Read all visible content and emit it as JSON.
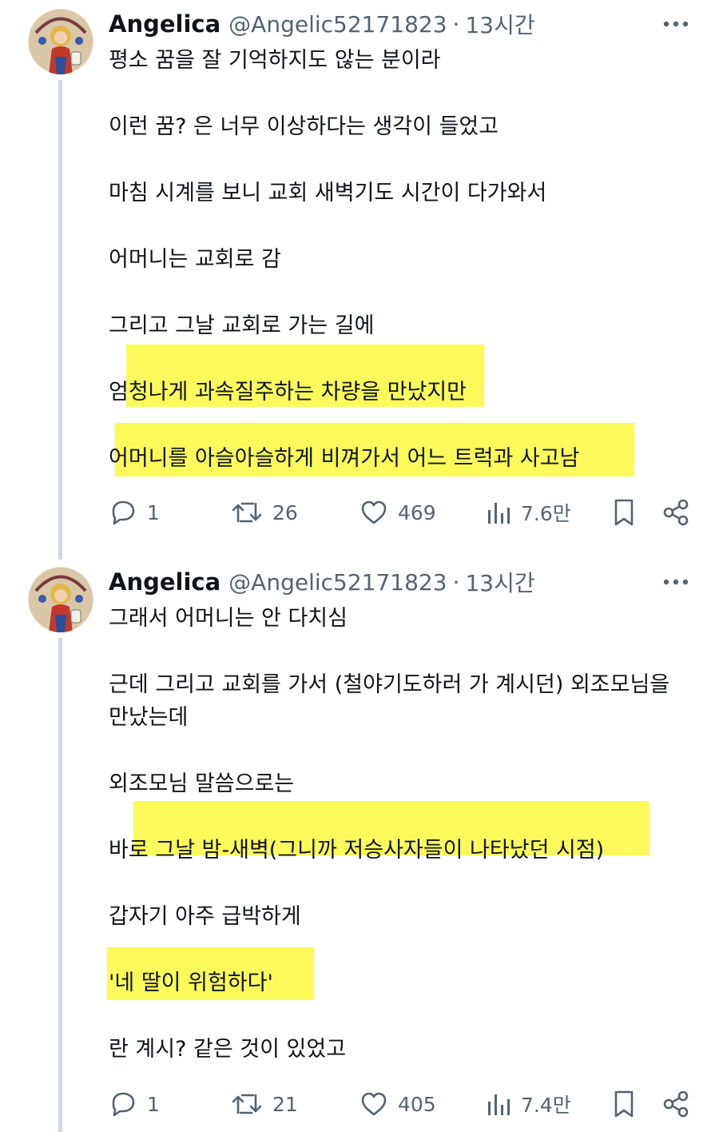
{
  "tweets": [
    {
      "author": {
        "name": "Angelica",
        "handle": "@Angelic52171823",
        "separator": "·",
        "time": "13시간"
      },
      "lines": [
        "평소 꿈을 잘 기억하지도 않는 분이라",
        "이런 꿈? 은 너무 이상하다는 생각이 들었고",
        "마침 시계를 보니 교회 새벽기도 시간이 다가와서",
        "어머니는 교회로 감",
        "그리고 그날 교회로 가는 길에",
        "엄청나게 과속질주하는 차량을 만났지만",
        "어머니를 아슬아슬하게 비껴가서 어느 트럭과 사고남"
      ],
      "stats": {
        "replies": "1",
        "retweets": "26",
        "likes": "469",
        "views": "7.6만"
      }
    },
    {
      "author": {
        "name": "Angelica",
        "handle": "@Angelic52171823",
        "separator": "·",
        "time": "13시간"
      },
      "lines": [
        "그래서 어머니는 안 다치심",
        "근데 그리고 교회를 가서 (철야기도하러 가 계시던) 외조모님을",
        "만났는데",
        "외조모님 말씀으로는",
        "바로 그날 밤-새벽(그니까 저승사자들이 나타났던 시점)",
        "갑자기 아주 급박하게",
        "'네 딸이 위험하다'",
        "란 계시? 같은 것이 있었고"
      ],
      "stats": {
        "replies": "1",
        "retweets": "21",
        "likes": "405",
        "views": "7.4만"
      }
    }
  ],
  "icons": {
    "avatar": "saint-portrait-avatar",
    "more": "more-horizontal-icon",
    "reply": "reply-bubble-icon",
    "retweet": "retweet-icon",
    "like": "heart-icon",
    "views": "views-bar-chart-icon",
    "bookmark": "bookmark-icon",
    "share": "share-icon"
  },
  "colors": {
    "highlight": "#fcf95a",
    "text": "#0f1419",
    "muted": "#536471",
    "thread_line": "#cfd9de"
  }
}
